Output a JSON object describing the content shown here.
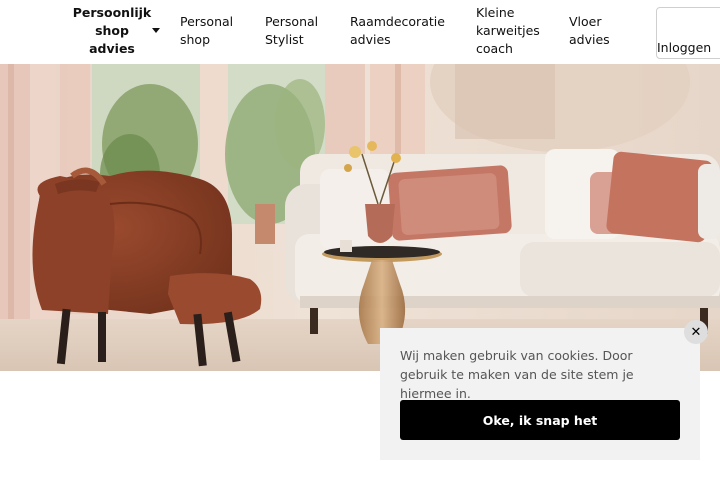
{
  "nav": {
    "items": [
      {
        "lines": [
          "Persoonlijk",
          "shop",
          "advies"
        ],
        "has_dropdown": true
      },
      {
        "lines": [
          "Personal",
          "shop"
        ]
      },
      {
        "lines": [
          "Personal",
          "Stylist"
        ]
      },
      {
        "lines": [
          "Raamdecoratie",
          "advies"
        ]
      },
      {
        "lines": [
          "Kleine",
          "karweitjes",
          "coach"
        ]
      },
      {
        "lines": [
          "Vloer",
          "advies"
        ]
      }
    ],
    "login_label": "Inloggen",
    "dropdown_icon": "caret-down-icon"
  },
  "hero": {
    "image_subject": "living room with rust velvet armchair, white sofa with pink cushions and gold side table"
  },
  "cookie": {
    "message": "Wij maken gebruik van cookies. Door gebruik te maken van de site stem je hiermee in.",
    "accept_label": "Oke, ik snap het",
    "close_glyph": "✕",
    "close_icon": "close-icon"
  },
  "colors": {
    "cookie_bg": "#f2f2f2",
    "button_bg": "#000000",
    "armchair": "#8a3f26",
    "sofa": "#ece6df",
    "cushion": "#c97d6c"
  }
}
